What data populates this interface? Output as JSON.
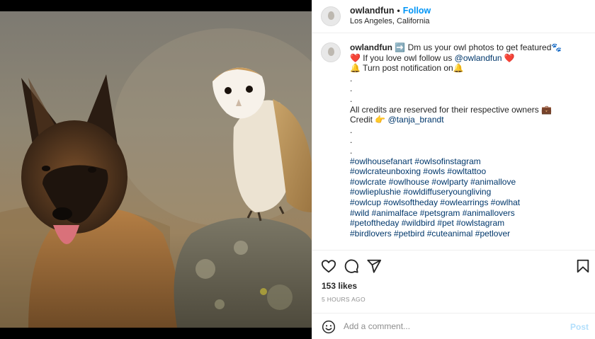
{
  "post": {
    "username": "owlandfun",
    "follow_label": "Follow",
    "location": "Los Angeles, California",
    "separator": "•"
  },
  "caption": {
    "username": "owlandfun",
    "lines": [
      "➡️ Dm us your owl photos to get featured🐾",
      "❤️ If you love owl follow us ",
      "🔔 Turn post notification on🔔",
      ".",
      ".",
      ".",
      "All credits are reserved for their respective owners 💼",
      "Credit 👉 ",
      ".",
      ".",
      "."
    ],
    "follow_mention": "@owlandfun",
    "follow_suffix": " ❤️",
    "credit_mention": "@tanja_brandt",
    "hashtag_lines": [
      "#owlhousefanart #owlsofinstagram",
      "#owlcrateunboxing #owls #owltattoo",
      "#owlcrate #owlhouse #owlparty #animallove",
      "#owlieplushie #owldiffuseryoungliving",
      "#owlcup #owlsoftheday #owlearrings #owlhat",
      "#wild #animalface #petsgram #animallovers",
      "#petoftheday #wildbird #pet #owlstagram",
      "#birdlovers #petbird #cuteanimal #petlover"
    ]
  },
  "actions": {
    "like_icon": "heart-icon",
    "comment_icon": "comment-icon",
    "share_icon": "send-icon",
    "save_icon": "bookmark-icon"
  },
  "stats": {
    "likes": "153 likes",
    "time": "5 HOURS AGO"
  },
  "comment": {
    "placeholder": "Add a comment...",
    "post_label": "Post"
  },
  "colors": {
    "accent": "#0095f6",
    "link": "#00376b",
    "post_disabled": "#b2dffc"
  }
}
